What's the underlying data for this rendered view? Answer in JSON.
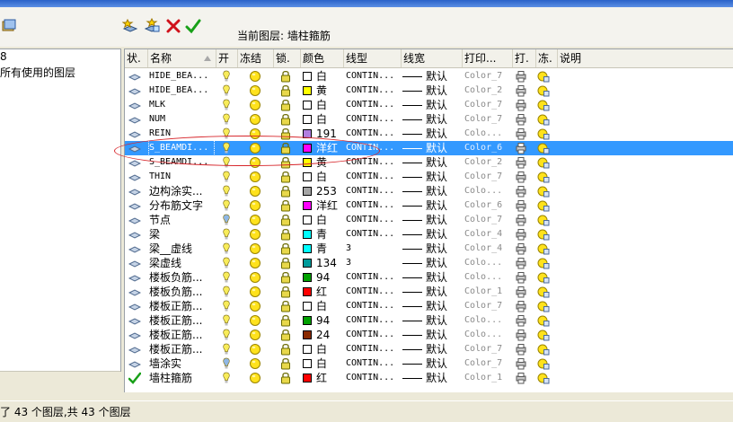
{
  "toolbar": {
    "current_layer_label": "当前图层: 墙柱箍筋"
  },
  "left_panel": {
    "tree_items": [
      "8",
      "所有使用的图层"
    ]
  },
  "columns": [
    "状.",
    "名称",
    "开",
    "冻结",
    "锁.",
    "颜色",
    "线型",
    "线宽",
    "打印...",
    "打.",
    "冻.",
    "说明"
  ],
  "status": {
    "text": "了 43 个图层,共 43 个图层"
  },
  "colors": {
    "selection": "#3399ff",
    "annotation_circle": "#d7262b"
  },
  "rows": [
    {
      "name": "HIDE_BEA...",
      "mono": true,
      "swatch": "#ffffff",
      "color_label": "白",
      "linetype": "CONTIN...",
      "lineweight": "默认",
      "plotstyle": "Color_7",
      "icon": "layer",
      "bulb": "#f8ec5a",
      "sel": false
    },
    {
      "name": "HIDE_BEA...",
      "mono": true,
      "swatch": "#ffff00",
      "color_label": "黄",
      "linetype": "CONTIN...",
      "lineweight": "默认",
      "plotstyle": "Color_2",
      "icon": "layer",
      "bulb": "#f8ec5a",
      "sel": false
    },
    {
      "name": "MLK",
      "mono": true,
      "swatch": "#ffffff",
      "color_label": "白",
      "linetype": "CONTIN...",
      "lineweight": "默认",
      "plotstyle": "Color_7",
      "icon": "layer",
      "bulb": "#f8ec5a",
      "sel": false
    },
    {
      "name": "NUM",
      "mono": true,
      "swatch": "#ffffff",
      "color_label": "白",
      "linetype": "CONTIN...",
      "lineweight": "默认",
      "plotstyle": "Color_7",
      "icon": "layer",
      "bulb": "#f8ec5a",
      "sel": false
    },
    {
      "name": "REIN",
      "mono": true,
      "swatch": "#b07ee0",
      "color_label": "191",
      "linetype": "CONTIN...",
      "lineweight": "默认",
      "plotstyle": "Colo...",
      "icon": "layer",
      "bulb": "#f8ec5a",
      "sel": false
    },
    {
      "name": "S_BEAMDI...",
      "mono": true,
      "swatch": "#ff00ff",
      "color_label": "洋红",
      "linetype": "CONTIN...",
      "lineweight": "默认",
      "plotstyle": "Color_6",
      "icon": "layer",
      "bulb": "#f8ec5a",
      "sel": true
    },
    {
      "name": "S_BEAMDI...",
      "mono": true,
      "swatch": "#ffff00",
      "color_label": "黄",
      "linetype": "CONTIN...",
      "lineweight": "默认",
      "plotstyle": "Color_2",
      "icon": "layer",
      "bulb": "#f8ec5a",
      "sel": false
    },
    {
      "name": "THIN",
      "mono": true,
      "swatch": "#ffffff",
      "color_label": "白",
      "linetype": "CONTIN...",
      "lineweight": "默认",
      "plotstyle": "Color_7",
      "icon": "layer",
      "bulb": "#f8ec5a",
      "sel": false
    },
    {
      "name": "边构涂实...",
      "mono": false,
      "swatch": "#a5a5a5",
      "color_label": "253",
      "linetype": "CONTIN...",
      "lineweight": "默认",
      "plotstyle": "Colo...",
      "icon": "layer",
      "bulb": "#f8ec5a",
      "sel": false
    },
    {
      "name": "分布筋文字",
      "mono": false,
      "swatch": "#ff00ff",
      "color_label": "洋红",
      "linetype": "CONTIN...",
      "lineweight": "默认",
      "plotstyle": "Color_6",
      "icon": "layer",
      "bulb": "#f8ec5a",
      "sel": false
    },
    {
      "name": "节点",
      "mono": false,
      "swatch": "#ffffff",
      "color_label": "白",
      "linetype": "CONTIN...",
      "lineweight": "默认",
      "plotstyle": "Color_7",
      "icon": "layer",
      "bulb": "#8fb7e6",
      "sel": false
    },
    {
      "name": "梁",
      "mono": false,
      "swatch": "#00ffff",
      "color_label": "青",
      "linetype": "CONTIN...",
      "lineweight": "默认",
      "plotstyle": "Color_4",
      "icon": "layer",
      "bulb": "#f8ec5a",
      "sel": false
    },
    {
      "name": "梁__虚线",
      "mono": false,
      "swatch": "#00ffff",
      "color_label": "青",
      "linetype": "3",
      "lineweight": "默认",
      "plotstyle": "Color_4",
      "icon": "layer",
      "bulb": "#f8ec5a",
      "sel": false
    },
    {
      "name": "梁虚线",
      "mono": false,
      "swatch": "#009a9a",
      "color_label": "134",
      "linetype": "3",
      "lineweight": "默认",
      "plotstyle": "Colo...",
      "icon": "layer",
      "bulb": "#f8ec5a",
      "sel": false
    },
    {
      "name": "楼板负筋...",
      "mono": false,
      "swatch": "#00a000",
      "color_label": "94",
      "linetype": "CONTIN...",
      "lineweight": "默认",
      "plotstyle": "Colo...",
      "icon": "layer",
      "bulb": "#f8ec5a",
      "sel": false
    },
    {
      "name": "楼板负筋...",
      "mono": false,
      "swatch": "#ff0000",
      "color_label": "红",
      "linetype": "CONTIN...",
      "lineweight": "默认",
      "plotstyle": "Color_1",
      "icon": "layer",
      "bulb": "#f8ec5a",
      "sel": false
    },
    {
      "name": "楼板正筋...",
      "mono": false,
      "swatch": "#ffffff",
      "color_label": "白",
      "linetype": "CONTIN...",
      "lineweight": "默认",
      "plotstyle": "Color_7",
      "icon": "layer",
      "bulb": "#f8ec5a",
      "sel": false
    },
    {
      "name": "楼板正筋...",
      "mono": false,
      "swatch": "#00a000",
      "color_label": "94",
      "linetype": "CONTIN...",
      "lineweight": "默认",
      "plotstyle": "Colo...",
      "icon": "layer",
      "bulb": "#f8ec5a",
      "sel": false
    },
    {
      "name": "楼板正筋...",
      "mono": false,
      "swatch": "#8a2a00",
      "color_label": "24",
      "linetype": "CONTIN...",
      "lineweight": "默认",
      "plotstyle": "Colo...",
      "icon": "layer",
      "bulb": "#f8ec5a",
      "sel": false
    },
    {
      "name": "楼板正筋...",
      "mono": false,
      "swatch": "#ffffff",
      "color_label": "白",
      "linetype": "CONTIN...",
      "lineweight": "默认",
      "plotstyle": "Color_7",
      "icon": "layer",
      "bulb": "#f8ec5a",
      "sel": false
    },
    {
      "name": "墙涂实",
      "mono": false,
      "swatch": "#ffffff",
      "color_label": "白",
      "linetype": "CONTIN...",
      "lineweight": "默认",
      "plotstyle": "Color_7",
      "icon": "layer",
      "bulb": "#8fb7e6",
      "sel": false
    },
    {
      "name": "墙柱箍筋",
      "mono": false,
      "swatch": "#ff0000",
      "color_label": "红",
      "linetype": "CONTIN...",
      "lineweight": "默认",
      "plotstyle": "Color_1",
      "icon": "check",
      "bulb": "#f8ec5a",
      "sel": false
    }
  ]
}
